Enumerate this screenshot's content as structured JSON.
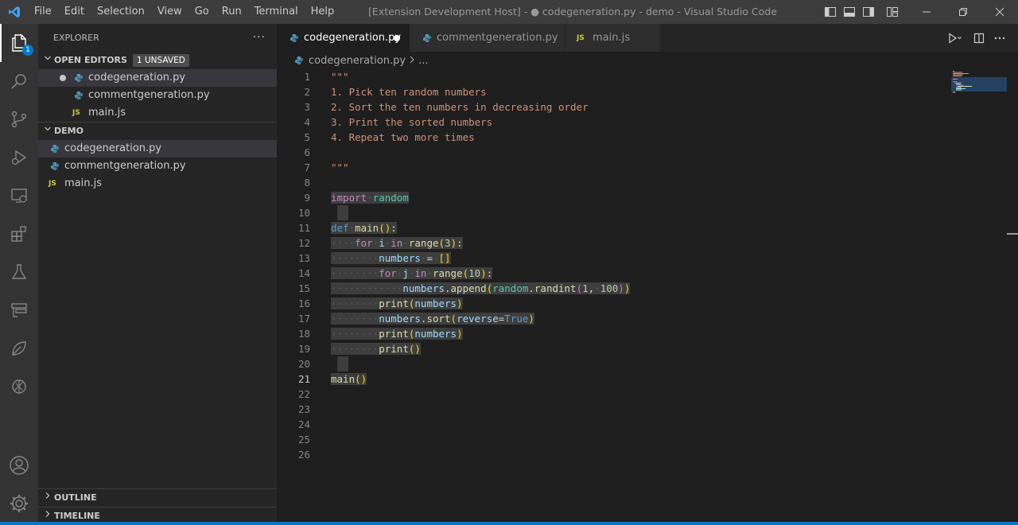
{
  "window": {
    "title": "[Extension Development Host] - ● codegeneration.py - demo - Visual Studio Code",
    "menu": [
      "File",
      "Edit",
      "Selection",
      "View",
      "Go",
      "Run",
      "Terminal",
      "Help"
    ]
  },
  "activity_bar": {
    "explorer_badge": "1"
  },
  "sidebar": {
    "title": "EXPLORER",
    "more": "···",
    "open_editors": {
      "label": "OPEN EDITORS",
      "badge": "1 UNSAVED",
      "items": [
        {
          "name": "codegeneration.py",
          "type": "py",
          "modified": true
        },
        {
          "name": "commentgeneration.py",
          "type": "py",
          "modified": false
        },
        {
          "name": "main.js",
          "type": "js",
          "modified": false
        }
      ]
    },
    "workspace": {
      "label": "DEMO",
      "items": [
        {
          "name": "codegeneration.py",
          "type": "py"
        },
        {
          "name": "commentgeneration.py",
          "type": "py"
        },
        {
          "name": "main.js",
          "type": "js"
        }
      ]
    },
    "outline_label": "OUTLINE",
    "timeline_label": "TIMELINE"
  },
  "tabs": [
    {
      "label": "codegeneration.py",
      "type": "py",
      "active": true,
      "dirty": true
    },
    {
      "label": "commentgeneration.py",
      "type": "py",
      "active": false
    },
    {
      "label": "main.js",
      "type": "js",
      "active": false
    }
  ],
  "breadcrumb": {
    "file": "codegeneration.py",
    "rest": "..."
  },
  "editor": {
    "current_line": 21,
    "line_numbers": [
      "1",
      "2",
      "3",
      "4",
      "5",
      "6",
      "7",
      "8",
      "9",
      "10",
      "11",
      "12",
      "13",
      "14",
      "15",
      "16",
      "17",
      "18",
      "19",
      "20",
      "21",
      "22",
      "23",
      "24",
      "25",
      "26"
    ],
    "lines": [
      "\"\"\"",
      "1. Pick ten random numbers",
      "2. Sort the ten numbers in decreasing order",
      "3. Print the sorted numbers",
      "4. Repeat two more times",
      "",
      "\"\"\"",
      "",
      "import random",
      "",
      "def main():",
      "    for i in range(3):",
      "        numbers = []",
      "        for j in range(10):",
      "            numbers.append(random.randint(1, 100))",
      "        print(numbers)",
      "        numbers.sort(reverse=True)",
      "        print(numbers)",
      "        print()",
      "",
      "main()",
      "",
      "",
      "",
      "",
      ""
    ]
  },
  "colors": {
    "accent": "#007acc",
    "string": "#ce9178",
    "keyword": "#c586c0",
    "function": "#dcdcaa",
    "variable": "#9cdcfe",
    "number": "#b5cea8"
  }
}
